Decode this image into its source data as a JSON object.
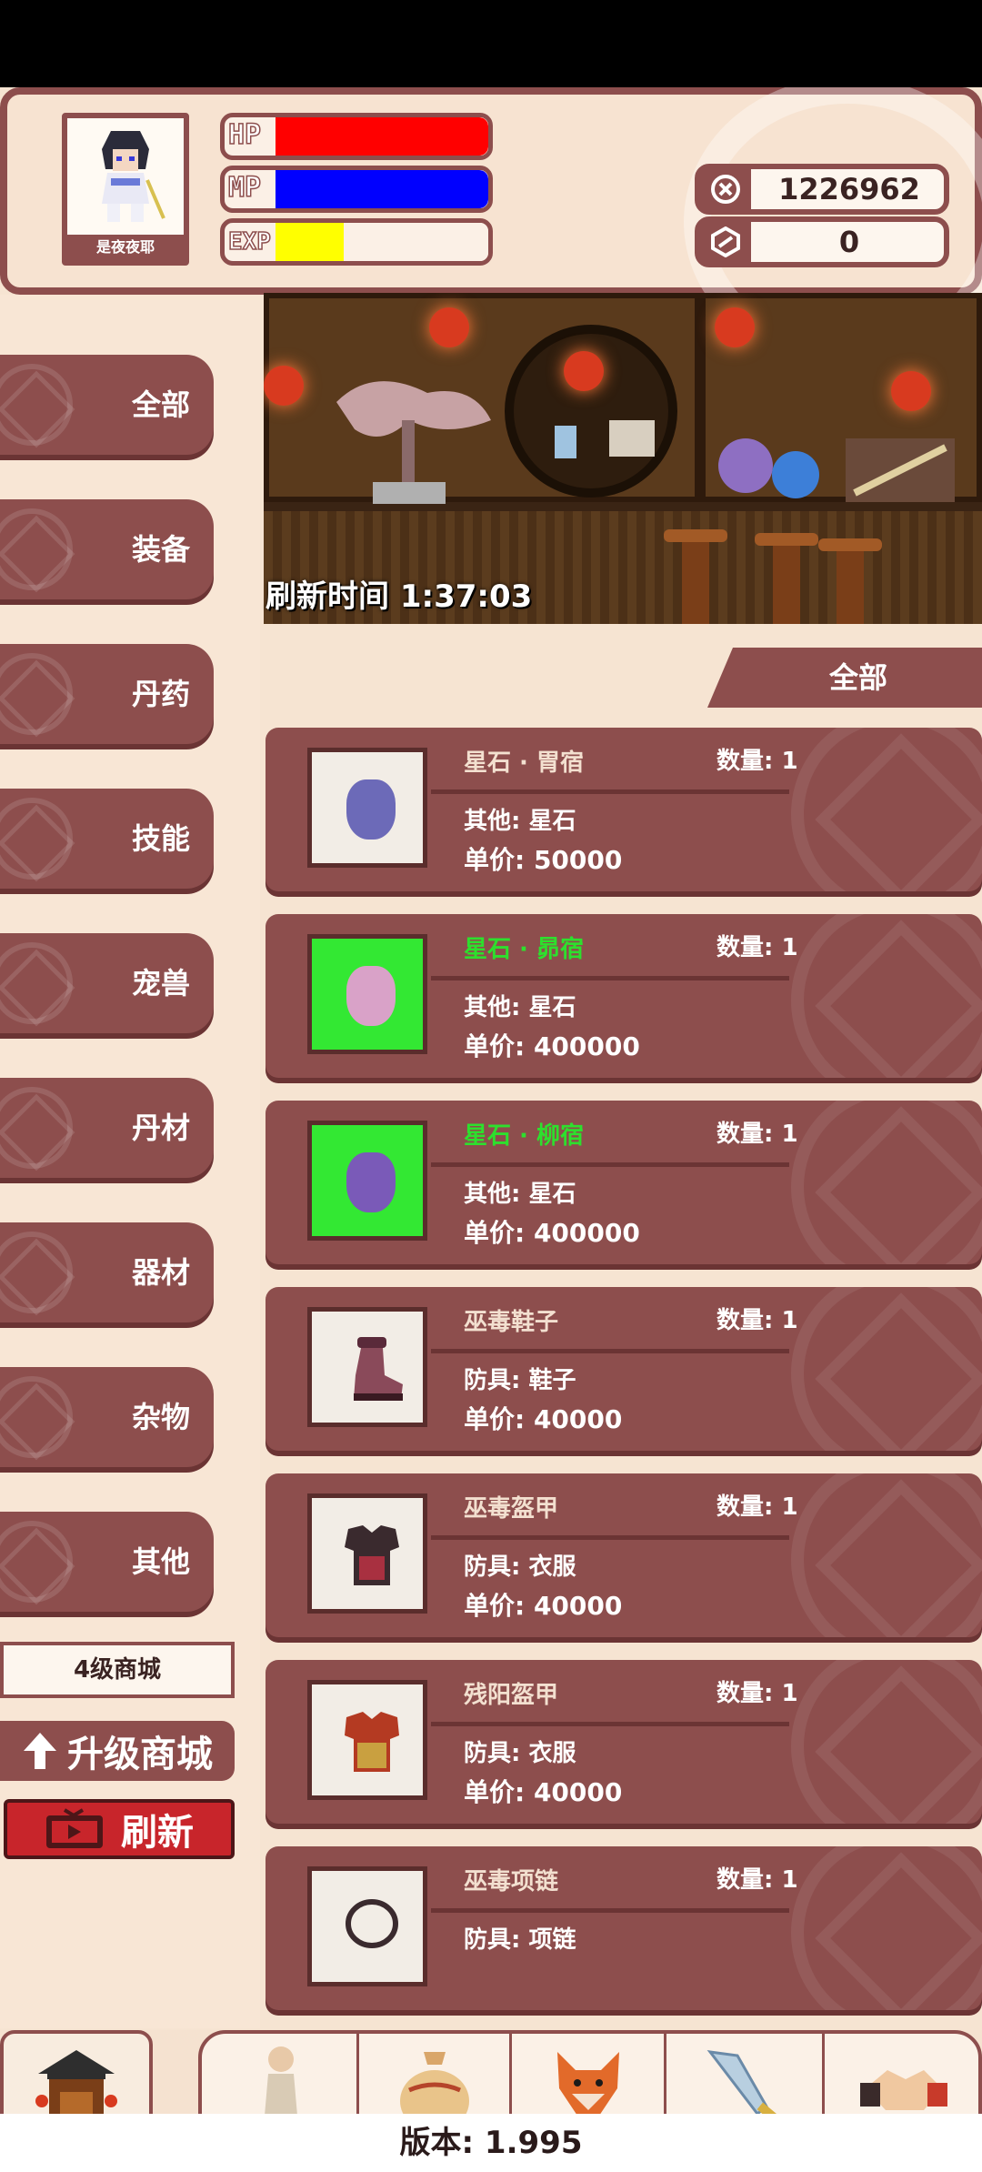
{
  "player": {
    "name": "是夜夜耶",
    "hp_label": "HP",
    "mp_label": "MP",
    "exp_label": "EXP",
    "hp_fill": 1.0,
    "mp_fill": 1.0,
    "exp_fill": 0.32
  },
  "currencies": {
    "coins": "1226962",
    "gems": "0"
  },
  "sidebar": {
    "items": [
      {
        "label": "全部"
      },
      {
        "label": "装备"
      },
      {
        "label": "丹药"
      },
      {
        "label": "技能"
      },
      {
        "label": "宠兽"
      },
      {
        "label": "丹材"
      },
      {
        "label": "器材"
      },
      {
        "label": "杂物"
      },
      {
        "label": "其他"
      }
    ],
    "level": "4级商城",
    "upgrade": "升级商城",
    "refresh": "刷新"
  },
  "banner": {
    "refresh_time": "刷新时间 1:37:03"
  },
  "filter": {
    "current": "全部"
  },
  "items": [
    {
      "name": "星石 · 胃宿",
      "qty": "数量: 1",
      "cat": "其他: 星石",
      "price": "单价: 50000"
    },
    {
      "name": "星石 · 昴宿",
      "qty": "数量: 1",
      "cat": "其他: 星石",
      "price": "单价: 400000"
    },
    {
      "name": "星石 · 柳宿",
      "qty": "数量: 1",
      "cat": "其他: 星石",
      "price": "单价: 400000"
    },
    {
      "name": "巫毒鞋子",
      "qty": "数量: 1",
      "cat": "防具: 鞋子",
      "price": "单价: 40000"
    },
    {
      "name": "巫毒盔甲",
      "qty": "数量: 1",
      "cat": "防具: 衣服",
      "price": "单价: 40000"
    },
    {
      "name": "残阳盔甲",
      "qty": "数量: 1",
      "cat": "防具: 衣服",
      "price": "单价: 40000"
    },
    {
      "name": "巫毒项链",
      "qty": "数量: 1",
      "cat": "防具: 项链",
      "price": ""
    }
  ],
  "nav": {
    "home": "主页",
    "role": "角色",
    "storage": "储物",
    "pet": "宠物",
    "skill": "技能",
    "social": "社交"
  },
  "version": "版本: 1.995",
  "colors": {
    "primary": "#8d4e4d",
    "hp": "#ff0000",
    "mp": "#0000ff",
    "exp": "#ffff00",
    "rare_name": "#2de02d"
  }
}
